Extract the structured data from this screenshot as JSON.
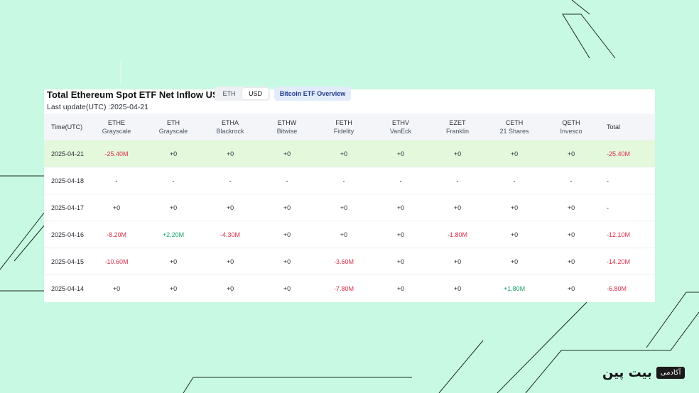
{
  "header": {
    "title": "Total Ethereum Spot ETF Net Inflow USD",
    "last_update": "Last update(UTC) :2025-04-21",
    "unit_toggle": [
      {
        "label": "ETH",
        "active": false
      },
      {
        "label": "USD",
        "active": true
      }
    ],
    "bitcoin_button": "Bitcoin ETF Overview"
  },
  "table": {
    "columns": [
      {
        "ticker": "Time(UTC)",
        "issuer": ""
      },
      {
        "ticker": "ETHE",
        "issuer": "Grayscale"
      },
      {
        "ticker": "ETH",
        "issuer": "Grayscale"
      },
      {
        "ticker": "ETHA",
        "issuer": "Blackrock"
      },
      {
        "ticker": "ETHW",
        "issuer": "Bitwise"
      },
      {
        "ticker": "FETH",
        "issuer": "Fidelity"
      },
      {
        "ticker": "ETHV",
        "issuer": "VanEck"
      },
      {
        "ticker": "EZET",
        "issuer": "Franklin"
      },
      {
        "ticker": "CETH",
        "issuer": "21 Shares"
      },
      {
        "ticker": "QETH",
        "issuer": "Invesco"
      },
      {
        "ticker": "Total",
        "issuer": ""
      }
    ],
    "rows": [
      [
        "2025-04-21",
        "-25.40M",
        "+0",
        "+0",
        "+0",
        "+0",
        "+0",
        "+0",
        "+0",
        "+0",
        "-25.40M"
      ],
      [
        "2025-04-18",
        "-",
        "-",
        "-",
        "-",
        "-",
        "-",
        "-",
        "-",
        "-",
        "-"
      ],
      [
        "2025-04-17",
        "+0",
        "+0",
        "+0",
        "+0",
        "+0",
        "+0",
        "+0",
        "+0",
        "+0",
        "-"
      ],
      [
        "2025-04-16",
        "-8.20M",
        "+2.20M",
        "-4.30M",
        "+0",
        "+0",
        "+0",
        "-1.80M",
        "+0",
        "+0",
        "-12.10M"
      ],
      [
        "2025-04-15",
        "-10.60M",
        "+0",
        "+0",
        "+0",
        "-3.60M",
        "+0",
        "+0",
        "+0",
        "+0",
        "-14.20M"
      ],
      [
        "2025-04-14",
        "+0",
        "+0",
        "+0",
        "+0",
        "-7.80M",
        "+0",
        "+0",
        "+1.80M",
        "+0",
        "-6.80M"
      ]
    ],
    "highlighted_row": 0
  },
  "logo": {
    "tag": "آکادمی",
    "word": "بیت پین"
  },
  "colors": {
    "background": "#c8f9e3",
    "negative": "#e0304a",
    "positive": "#1aa66a",
    "highlight_row": "#e4f8dc"
  }
}
